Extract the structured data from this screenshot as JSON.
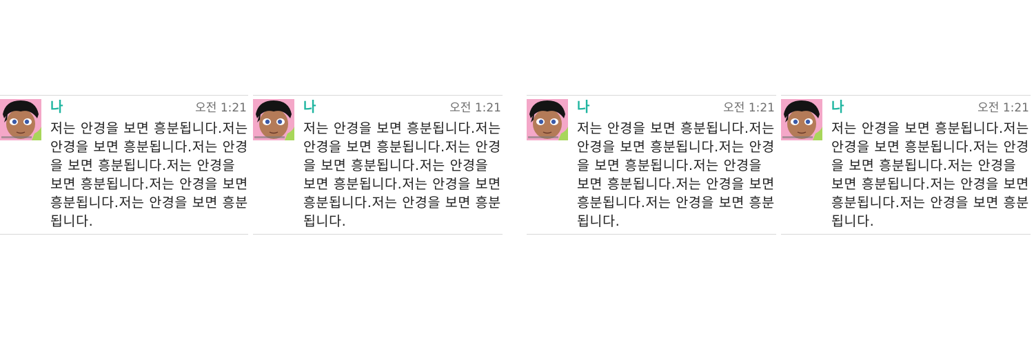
{
  "messages": [
    {
      "sender": "나",
      "time": "오전 1:21",
      "text": "저는 안경을 보면 흥분됩니다.저는 안경을 보면 흥분됩니다.저는 안경을 보면 흥분됩니다.저는 안경을 보면 흥분됩니다.저는 안경을 보면 흥분됩니다.저는 안경을 보면 흥분됩니다."
    },
    {
      "sender": "나",
      "time": "오전 1:21",
      "text": "저는 안경을 보면 흥분됩니다.저는 안경을 보면 흥분됩니다.저는 안경을 보면 흥분됩니다.저는 안경을 보면 흥분됩니다.저는 안경을 보면 흥분됩니다.저는 안경을 보면 흥분됩니다."
    },
    {
      "sender": "나",
      "time": "오전 1:21",
      "text": "저는 안경을 보면 흥분됩니다.저는 안경을 보면 흥분됩니다.저는 안경을 보면 흥분됩니다.저는 안경을 보면 흥분됩니다.저는 안경을 보면 흥분됩니다.저는 안경을 보면 흥분됩니다."
    },
    {
      "sender": "나",
      "time": "오전 1:21",
      "text": "저는 안경을 보면 흥분됩니다.저는 안경을 보면 흥분됩니다.저는 안경을 보면 흥분됩니다.저는 안경을 보면 흥분됩니다.저는 안경을 보면 흥분됩니다.저는 안경을 보면 흥분됩니다."
    }
  ],
  "colors": {
    "sender_name": "#1fb5a0",
    "timestamp": "#6d6d6d",
    "message_text": "#222222",
    "divider": "#d8d8d8",
    "avatar_background": "#f4a7c8"
  },
  "icons": {
    "avatar": "anime-character-avatar-icon"
  }
}
